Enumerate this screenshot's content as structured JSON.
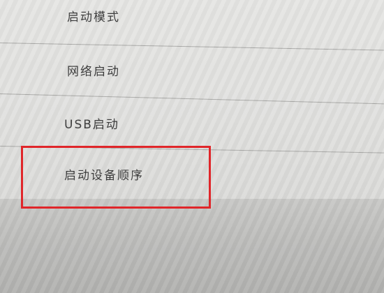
{
  "menu": {
    "items": [
      {
        "label": "启动模式"
      },
      {
        "label": "网络启动"
      },
      {
        "label": "USB启动"
      },
      {
        "label": "启动设备顺序"
      }
    ]
  },
  "annotation": {
    "highlight_color": "#e0262a",
    "highlighted_item": "启动设备顺序"
  },
  "colors": {
    "background": "#e3e3e1",
    "text": "#3a3a3a",
    "divider": "#a9a9a7"
  }
}
